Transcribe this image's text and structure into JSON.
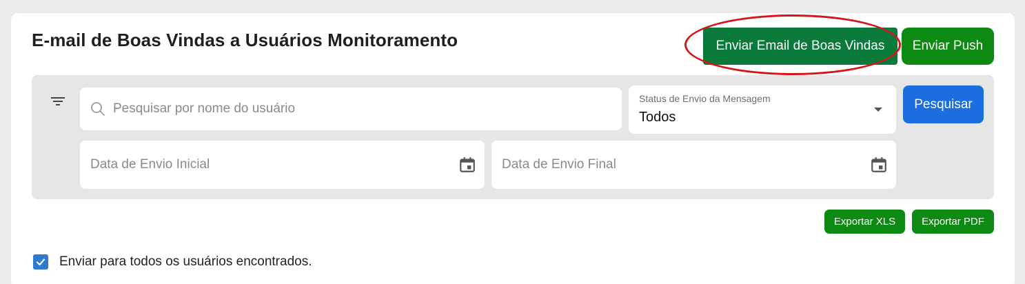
{
  "header": {
    "title": "E-mail de Boas Vindas a Usuários Monitoramento",
    "send_welcome_label": "Enviar Email de Boas Vindas",
    "send_push_label": "Enviar Push"
  },
  "filters": {
    "search_placeholder": "Pesquisar por nome do usuário",
    "status_label": "Status de Envio da Mensagem",
    "status_value": "Todos",
    "search_button_label": "Pesquisar",
    "date_start_placeholder": "Data de Envio Inicial",
    "date_end_placeholder": "Data de Envio Final"
  },
  "export": {
    "xls_label": "Exportar XLS",
    "pdf_label": "Exportar PDF"
  },
  "send_all": {
    "checked": true,
    "label": "Enviar para todos os usuários encontrados."
  },
  "colors": {
    "welcome_button": "#0a7a3b",
    "push_button": "#0c8a12",
    "search_button": "#1b6ee0",
    "highlight": "#d4161a",
    "checkbox": "#2f7bd1"
  },
  "icons": [
    "filter-icon",
    "search-icon",
    "calendar-icon",
    "check-icon",
    "chevron-down-icon"
  ]
}
